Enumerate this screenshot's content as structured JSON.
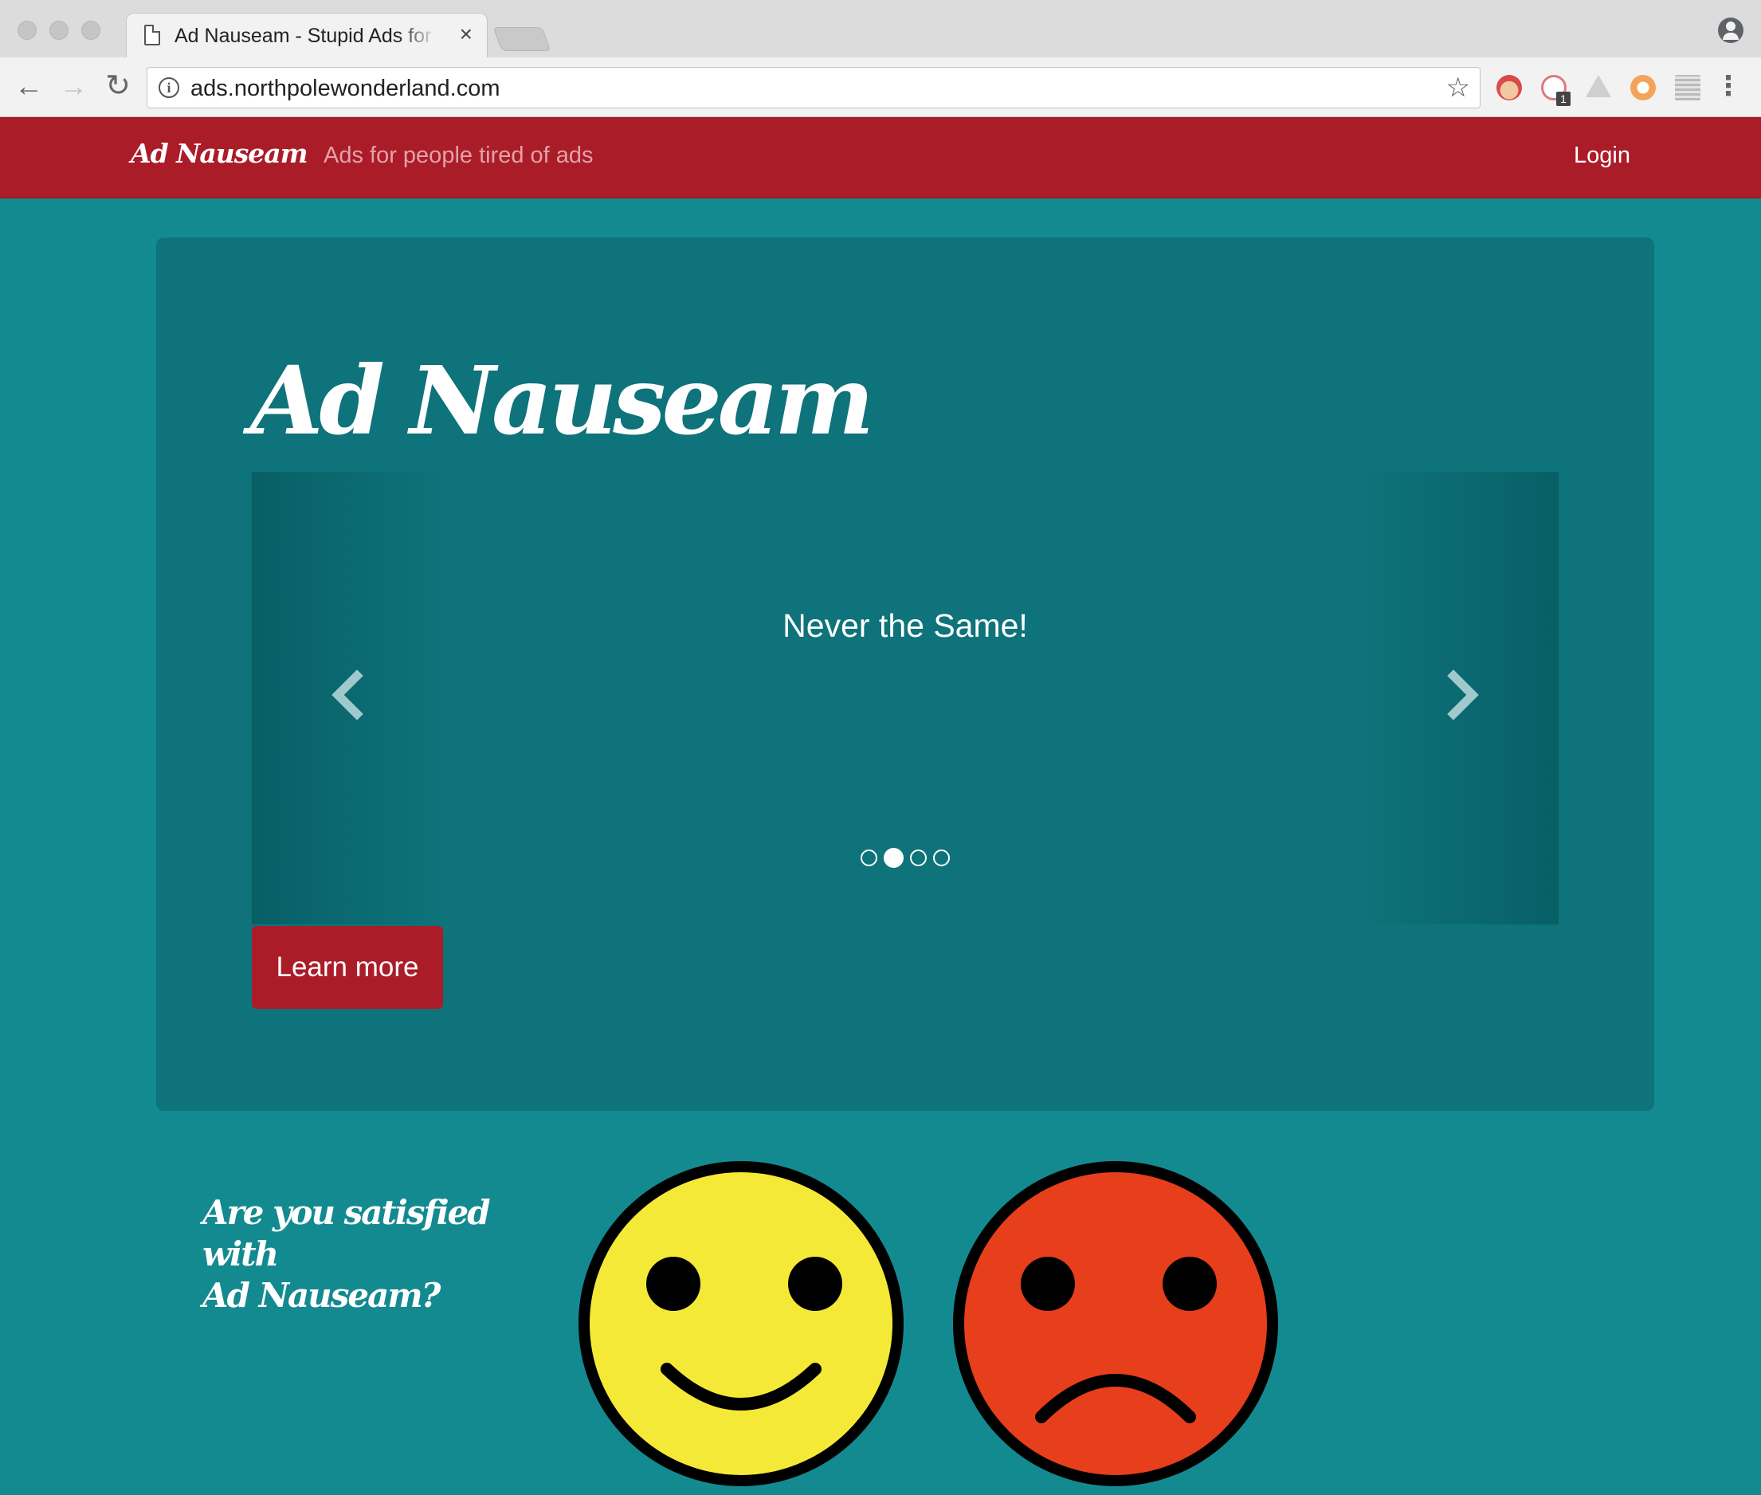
{
  "browser": {
    "tab_title": "Ad Nauseam - Stupid Ads for Stupid People",
    "tab_close": "×",
    "url": "ads.northpolewonderland.com",
    "back": "←",
    "forward": "→",
    "reload": "↻",
    "star": "☆",
    "menu": "⋮",
    "info": "i",
    "extension_badge": "1"
  },
  "site": {
    "brand": "Ad Nauseam",
    "tagline": "Ads for people tired of ads",
    "login": "Login"
  },
  "jumbotron": {
    "title": "Ad Nauseam",
    "carousel": {
      "caption": "Never the Same!",
      "slide_count": 4,
      "active_index": 1
    },
    "learn_more": "Learn more"
  },
  "rating": {
    "question_line1": "Are you satisfied with",
    "question_line2": "Ad Nauseam?",
    "happy_color": "#f4e936",
    "sad_color": "#e73e1c"
  },
  "colors": {
    "page_bg": "#138a90",
    "jumbotron_bg": "#0e737a",
    "navbar_bg": "#ab1c29",
    "button_bg": "#ab1c29"
  }
}
